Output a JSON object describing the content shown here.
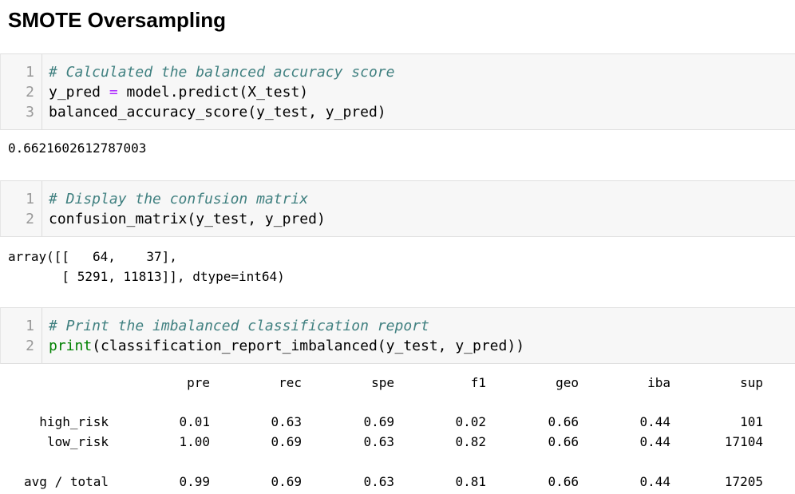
{
  "heading": "SMOTE Oversampling",
  "cells": [
    {
      "lines": [
        {
          "num": "1",
          "comment": "# Calculated the balanced accuracy score"
        },
        {
          "num": "2",
          "lhs": "y_pred ",
          "op": "=",
          "rhs": " model.predict(X_test)"
        },
        {
          "num": "3",
          "code": "balanced_accuracy_score(y_test, y_pred)"
        }
      ],
      "output": "0.6621602612787003"
    },
    {
      "lines": [
        {
          "num": "1",
          "comment": "# Display the confusion matrix"
        },
        {
          "num": "2",
          "code": "confusion_matrix(y_test, y_pred)"
        }
      ],
      "output_lines": [
        "array([[   64,    37],",
        "       [ 5291, 11813]], dtype=int64)"
      ]
    },
    {
      "lines": [
        {
          "num": "1",
          "comment": "# Print the imbalanced classification report"
        },
        {
          "num": "2",
          "kw": "print",
          "code": "(classification_report_imbalanced(y_test, y_pred))"
        }
      ]
    }
  ],
  "report": {
    "columns": [
      "pre",
      "rec",
      "spe",
      "f1",
      "geo",
      "iba",
      "sup"
    ],
    "rows": [
      {
        "label": "high_risk",
        "values": [
          "0.01",
          "0.63",
          "0.69",
          "0.02",
          "0.66",
          "0.44",
          "101"
        ]
      },
      {
        "label": "low_risk",
        "values": [
          "1.00",
          "0.69",
          "0.63",
          "0.82",
          "0.66",
          "0.44",
          "17104"
        ]
      },
      {
        "label": "avg / total",
        "values": [
          "0.99",
          "0.69",
          "0.63",
          "0.81",
          "0.66",
          "0.44",
          "17205"
        ]
      }
    ]
  }
}
